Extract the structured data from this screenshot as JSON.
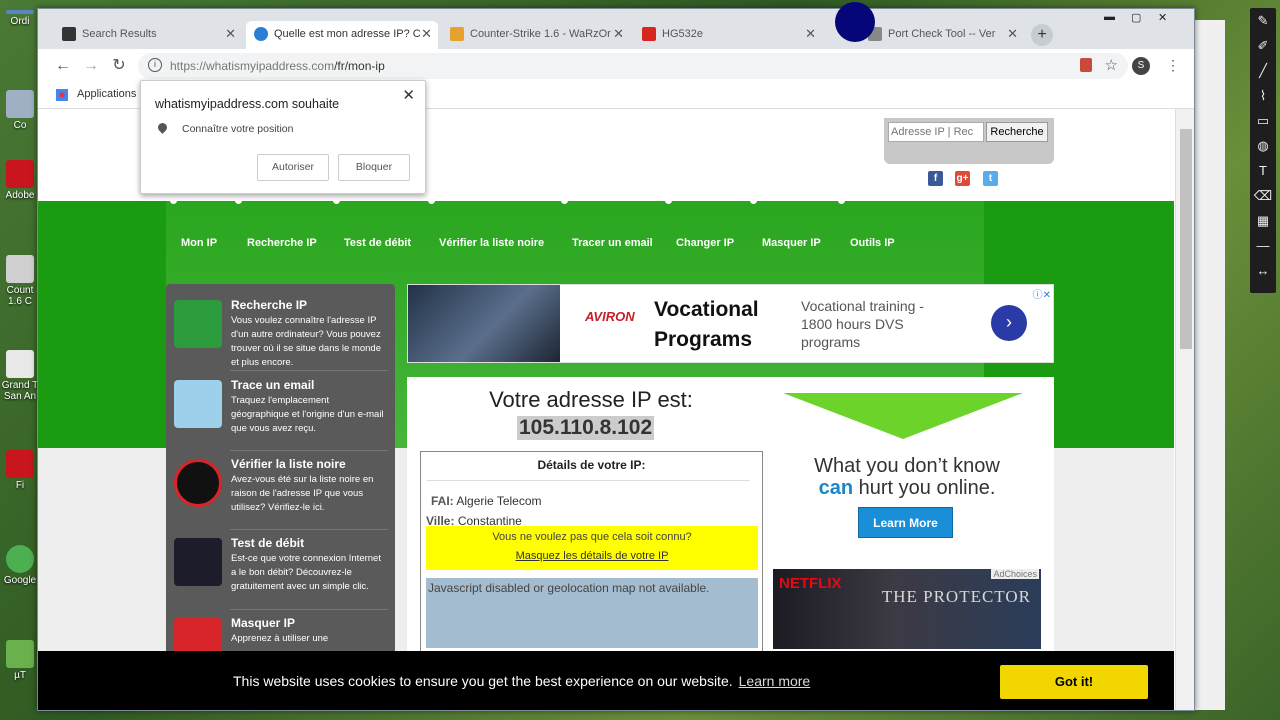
{
  "desktop": {
    "icons": [
      {
        "label": "Ordi"
      },
      {
        "label": "Co"
      },
      {
        "label": "Adobe"
      },
      {
        "label": "Count 1.6 C"
      },
      {
        "label": "Grand T San An"
      },
      {
        "label": "Fi"
      },
      {
        "label": "Google"
      },
      {
        "label": "µT"
      }
    ]
  },
  "browser": {
    "tabs": [
      {
        "title": "Search Results",
        "favicon": "search-favicon",
        "color": "#333333"
      },
      {
        "title": "Quelle est mon adresse IP? C",
        "favicon": "globe-favicon",
        "color": "#2a7fd4"
      },
      {
        "title": "Counter-Strike 1.6 - WaRzOr",
        "favicon": "shield-favicon",
        "color": "#e7a12e"
      },
      {
        "title": "HG532e",
        "favicon": "huawei-favicon",
        "color": "#d7261f"
      },
      {
        "title": "Port Check Tool -- Ver",
        "favicon": "port-favicon",
        "color": "#888888"
      }
    ],
    "url_host": "https://whatismyipaddress.com",
    "url_path": "/fr/mon-ip",
    "bookmarks": {
      "apps_label": "Applications"
    },
    "profile_initial": "S"
  },
  "permission_popup": {
    "title": "whatismyipaddress.com souhaite",
    "request": "Connaître votre position",
    "allow": "Autoriser",
    "block": "Bloquer"
  },
  "site": {
    "search": {
      "placeholder": "Adresse IP | Rec",
      "button": "Recherche"
    },
    "social": [
      "f",
      "g+",
      "t"
    ],
    "nav": [
      "Mon IP",
      "Recherche IP",
      "Test de débit",
      "Vérifier la liste noire",
      "Tracer un email",
      "Changer IP",
      "Masquer IP",
      "Outils IP"
    ],
    "sidebar": [
      {
        "title": "Recherche IP",
        "desc": "Vous voulez connaître l'adresse IP d'un autre ordinateur? Vous pouvez trouver où il se situe dans le monde et plus encore.",
        "icon": "magnifier-ip-icon"
      },
      {
        "title": "Trace un email",
        "desc": "Traquez l'emplacement géographique et l'origine d'un e-mail que vous avez reçu.",
        "icon": "map-trace-icon"
      },
      {
        "title": "Vérifier la liste noire",
        "desc": "Avez-vous été sur la liste noire en raison de l'adresse IP que vous utilisez? Vérifiez-le ici.",
        "icon": "blacklist-ip-icon"
      },
      {
        "title": "Test de débit",
        "desc": "Est-ce que votre connexion Internet a le bon débit? Découvrez-le gratuitement avec un simple clic.",
        "icon": "speedometer-icon"
      },
      {
        "title": "Masquer IP",
        "desc": "Apprenez à utiliser une",
        "icon": "mask-ip-icon"
      }
    ],
    "top_ad": {
      "logo": "AVIRON",
      "headline": "Vocational Programs",
      "sub": "Vocational training - 1800 hours DVS programs"
    },
    "ip": {
      "title": "Votre adresse IP est:",
      "value": "105.110.8.102",
      "details_title": "Détails de votre IP:",
      "fai_label": "FAI:",
      "fai": "Algerie Telecom",
      "ville_label": "Ville:",
      "ville": "Constantine",
      "hide_question": "Vous ne voulez pas que cela soit connu?",
      "hide_link": "Masquez les détails de votre IP",
      "map_msg": "Javascript disabled or geolocation map not available."
    },
    "side_ad": {
      "line1": "What you don’t know",
      "can": "can",
      "line2_rest": "hurt you online.",
      "button": "Learn More"
    },
    "netflix_ad": {
      "brand": "NETFLIX",
      "show": "THE PROTECTOR",
      "adchoices": "AdChoices"
    }
  },
  "cookie": {
    "message": "This website uses cookies to ensure you get the best experience on our website.",
    "learn_more": "Learn more",
    "button": "Got it!"
  },
  "colors": {
    "green": "#1a9b12",
    "cookie_button": "#f1d600",
    "highlight": "#ffff00"
  }
}
